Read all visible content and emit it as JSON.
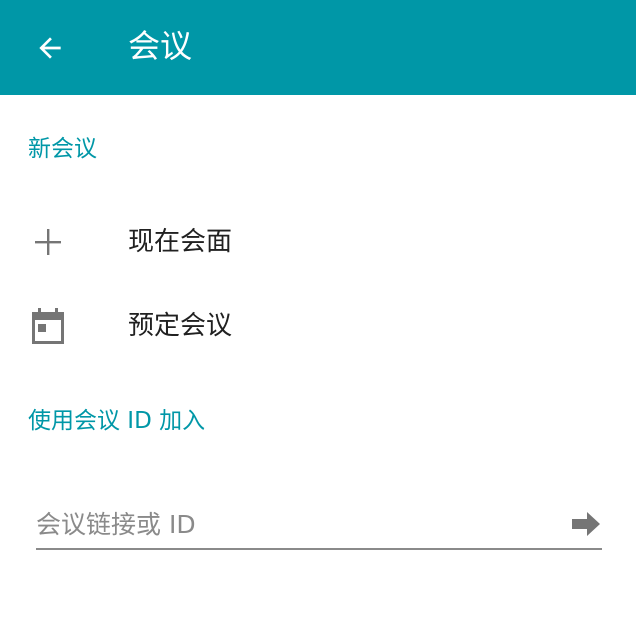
{
  "header": {
    "title": "会议",
    "back_icon": "arrow-left-icon",
    "background_color": "#0097a7"
  },
  "new_meeting": {
    "section_title": "新会议",
    "items": [
      {
        "label": "现在会面",
        "icon": "plus-icon"
      },
      {
        "label": "预定会议",
        "icon": "calendar-icon"
      }
    ]
  },
  "join": {
    "section_title": "使用会议 ID 加入",
    "input": {
      "value": "",
      "placeholder": "会议链接或 ID"
    },
    "submit_icon": "arrow-right-icon"
  },
  "colors": {
    "accent": "#0097a7",
    "icon_gray": "#757575",
    "text": "#212121"
  }
}
